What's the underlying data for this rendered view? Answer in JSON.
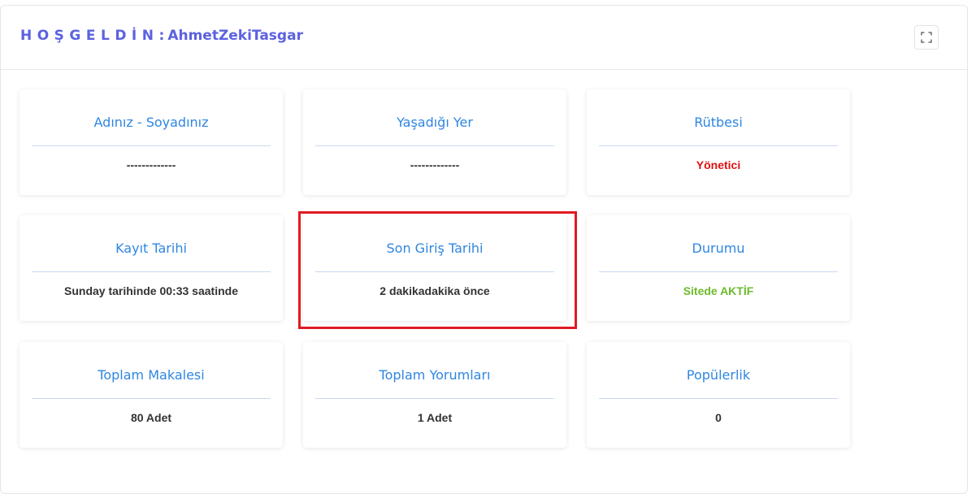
{
  "header": {
    "greeting": "HOŞGELDİN",
    "colon": ":",
    "username": "AhmetZekiTasgar",
    "fullscreen_icon": "expand-icon"
  },
  "cards": [
    {
      "title": "Adınız - Soyadınız",
      "value": "-------------"
    },
    {
      "title": "Yaşadığı Yer",
      "value": "-------------"
    },
    {
      "title": "Rütbesi",
      "value": "Yönetici"
    },
    {
      "title": "Kayıt Tarihi",
      "value": "Sunday tarihinde 00:33 saatinde"
    },
    {
      "title": "Son Giriş Tarihi",
      "value": "2 dakikadakika önce"
    },
    {
      "title": "Durumu",
      "value": "Sitede AKTİF"
    },
    {
      "title": "Toplam Makalesi",
      "value": "80 Adet"
    },
    {
      "title": "Toplam Yorumları",
      "value": "1 Adet"
    },
    {
      "title": "Popülerlik",
      "value": "0"
    }
  ],
  "colors": {
    "title": "#5b62e0",
    "card_title": "#2f86e0",
    "rank_value": "#e01010",
    "status_value": "#6dbb2c",
    "highlight_border": "#e01a22"
  }
}
